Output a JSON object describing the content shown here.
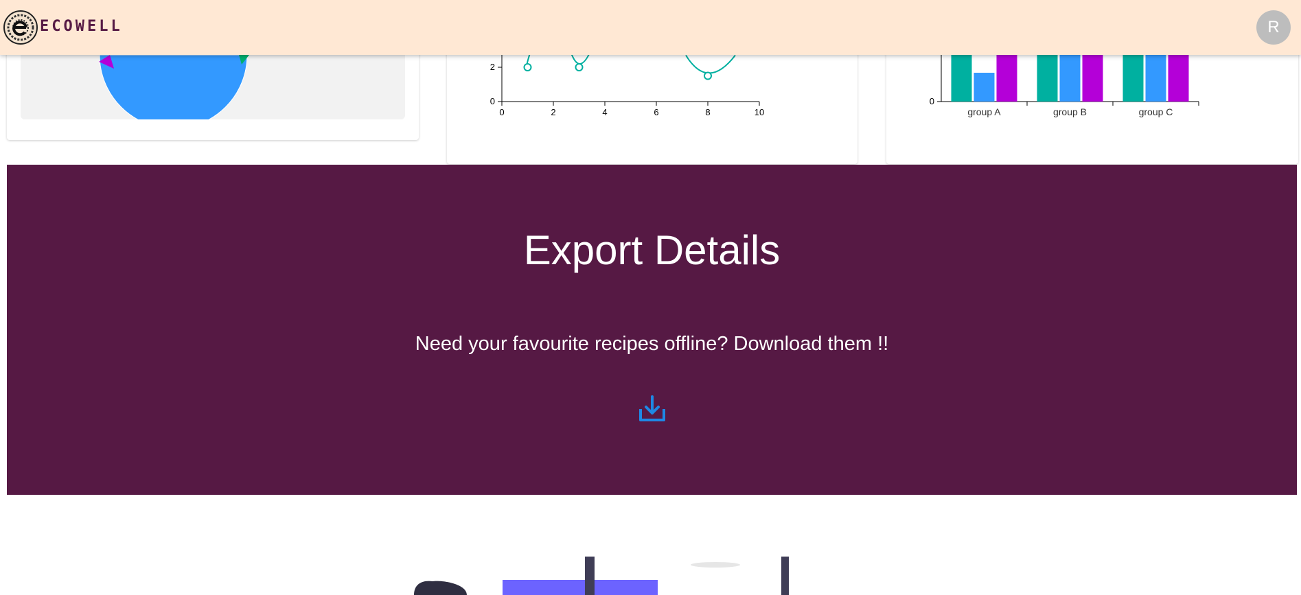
{
  "header": {
    "brand": "ECOWELL",
    "avatar_initial": "R"
  },
  "colors": {
    "header_bg": "#ffe8d4",
    "brand": "#571a45",
    "export_bg": "#561944",
    "teal": "#00b0a0",
    "blue": "#3399ff",
    "magenta": "#b400d8",
    "download_icon": "#1e88e5"
  },
  "chart_data": [
    {
      "type": "pie",
      "slices_visible": [
        "blue",
        "magenta",
        "green"
      ]
    },
    {
      "type": "line",
      "xlim": [
        0,
        10
      ],
      "x_ticks": [
        "0",
        "2",
        "4",
        "6",
        "8",
        "10"
      ],
      "y_ticks": [
        "0",
        "2"
      ],
      "points": [
        {
          "x": 1,
          "y": 2
        },
        {
          "x": 3,
          "y": 2
        },
        {
          "x": 8,
          "y": 1.5
        }
      ]
    },
    {
      "type": "bar",
      "categories": [
        "group A",
        "group B",
        "group C"
      ],
      "y_ticks": [
        "0"
      ],
      "series": [
        {
          "color": "#00b0a0"
        },
        {
          "color": "#3399ff"
        },
        {
          "color": "#b400d8"
        }
      ]
    }
  ],
  "export": {
    "title": "Export Details",
    "subtitle": "Need your favourite recipes offline? Download them !!",
    "download_icon": "download-icon"
  }
}
